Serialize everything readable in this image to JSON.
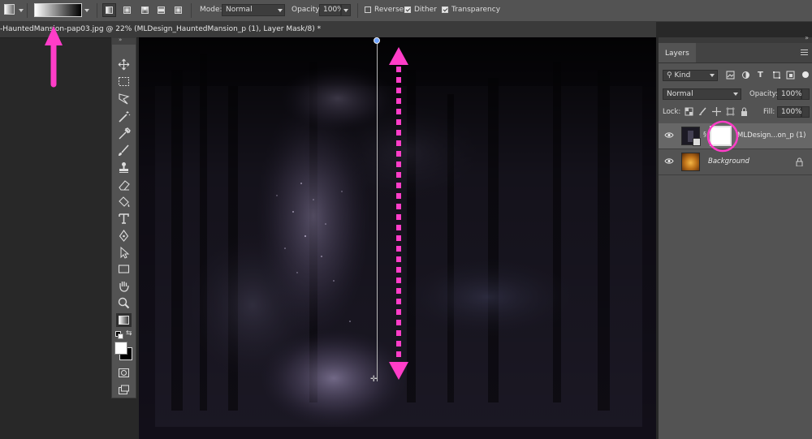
{
  "options_bar": {
    "mode_label": "Mode:",
    "mode_value": "Normal",
    "opacity_label": "Opacity:",
    "opacity_value": "100%",
    "reverse_label": "Reverse",
    "reverse_checked": false,
    "dither_label": "Dither",
    "dither_checked": true,
    "transparency_label": "Transparency",
    "transparency_checked": true
  },
  "document": {
    "tab_title": "-HauntedMansion-pap03.jpg @ 22% (MLDesign_HauntedMansion_p (1), Layer Mask/8) *"
  },
  "layers_panel": {
    "tab_label": "Layers",
    "filter_value": "Kind",
    "blend_mode": "Normal",
    "opacity_label": "Opacity:",
    "opacity_value": "100%",
    "lock_label": "Lock:",
    "fill_label": "Fill:",
    "fill_value": "100%",
    "layers": [
      {
        "name": "MLDesign...on_p (1)",
        "selected": true
      },
      {
        "name": "Background",
        "selected": false,
        "locked": true
      }
    ]
  },
  "colors": {
    "annotation": "#ff3dc8",
    "accent": "#6fa3ff"
  }
}
